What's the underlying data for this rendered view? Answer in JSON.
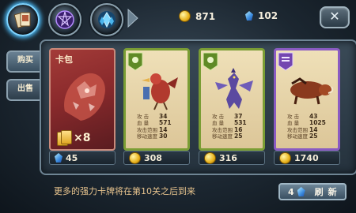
{
  "topbar": {
    "tabs": [
      {
        "icon": "cards-tab-icon"
      },
      {
        "icon": "pentagram-tab-icon"
      },
      {
        "icon": "crystal-tab-icon"
      }
    ],
    "gold": "871",
    "gems": "102",
    "close_icon": "close-icon"
  },
  "side_tabs": {
    "buy": "购买",
    "sell": "出售"
  },
  "pack": {
    "title": "卡包",
    "count": "×8",
    "price": "45"
  },
  "cards": [
    {
      "atk": "34",
      "hp": "571",
      "atk_range": "14",
      "move": "30",
      "price": "308",
      "rarity_color": "#7a9d34"
    },
    {
      "atk": "37",
      "hp": "531",
      "atk_range": "16",
      "move": "25",
      "price": "316",
      "rarity_color": "#7a9d34"
    },
    {
      "atk": "43",
      "hp": "1025",
      "atk_range": "14",
      "move": "25",
      "price": "1740",
      "rarity_color": "#8a5bc2"
    }
  ],
  "stat_labels": {
    "atk": "攻 击",
    "hp": "血 量",
    "atk_range": "攻击范围",
    "move": "移动速度"
  },
  "footer": {
    "message": "更多的强力卡牌将在第10关之后到来"
  },
  "refresh": {
    "cost": "4",
    "label": "刷新"
  }
}
